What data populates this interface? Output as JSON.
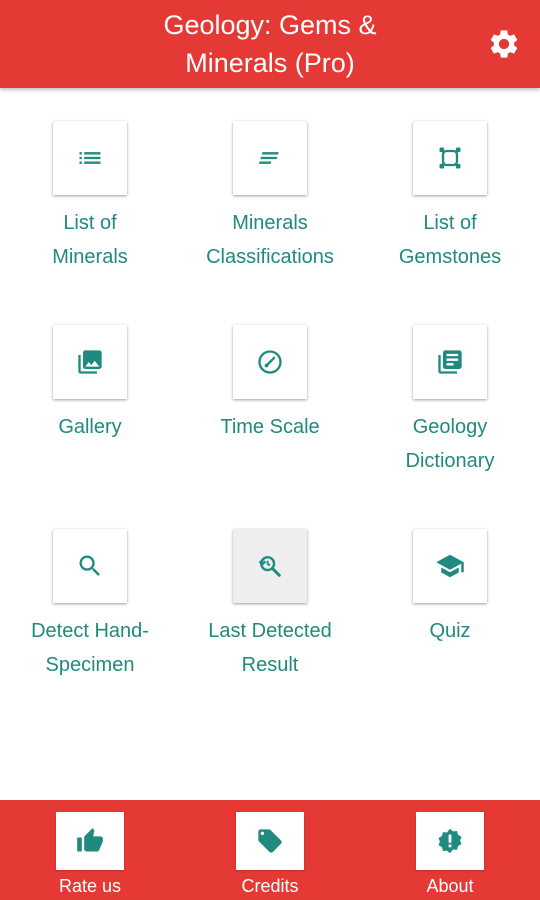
{
  "app": {
    "title": "Geology: Gems &\nMinerals (Pro)",
    "accent_color": "#e53935",
    "icon_color": "#1f8a7d",
    "settings_icon": "gear-icon"
  },
  "menu": {
    "items": [
      {
        "label": "List of\nMinerals",
        "icon": "list-icon"
      },
      {
        "label": "Minerals\nClassifications",
        "icon": "short-text-icon"
      },
      {
        "label": "List of\nGemstones",
        "icon": "gem-frame-icon"
      },
      {
        "label": "Gallery",
        "icon": "image-icon"
      },
      {
        "label": "Time Scale",
        "icon": "gauge-icon"
      },
      {
        "label": "Geology\nDictionary",
        "icon": "library-books-icon"
      },
      {
        "label": "Detect Hand-\nSpecimen",
        "icon": "search-icon"
      },
      {
        "label": "Last Detected\nResult",
        "icon": "search-history-icon"
      },
      {
        "label": "Quiz",
        "icon": "graduation-cap-icon"
      }
    ]
  },
  "bottom_nav": {
    "items": [
      {
        "label": "Rate us",
        "icon": "thumb-up-icon"
      },
      {
        "label": "Credits",
        "icon": "tag-icon"
      },
      {
        "label": "About",
        "icon": "info-badge-icon"
      }
    ]
  }
}
